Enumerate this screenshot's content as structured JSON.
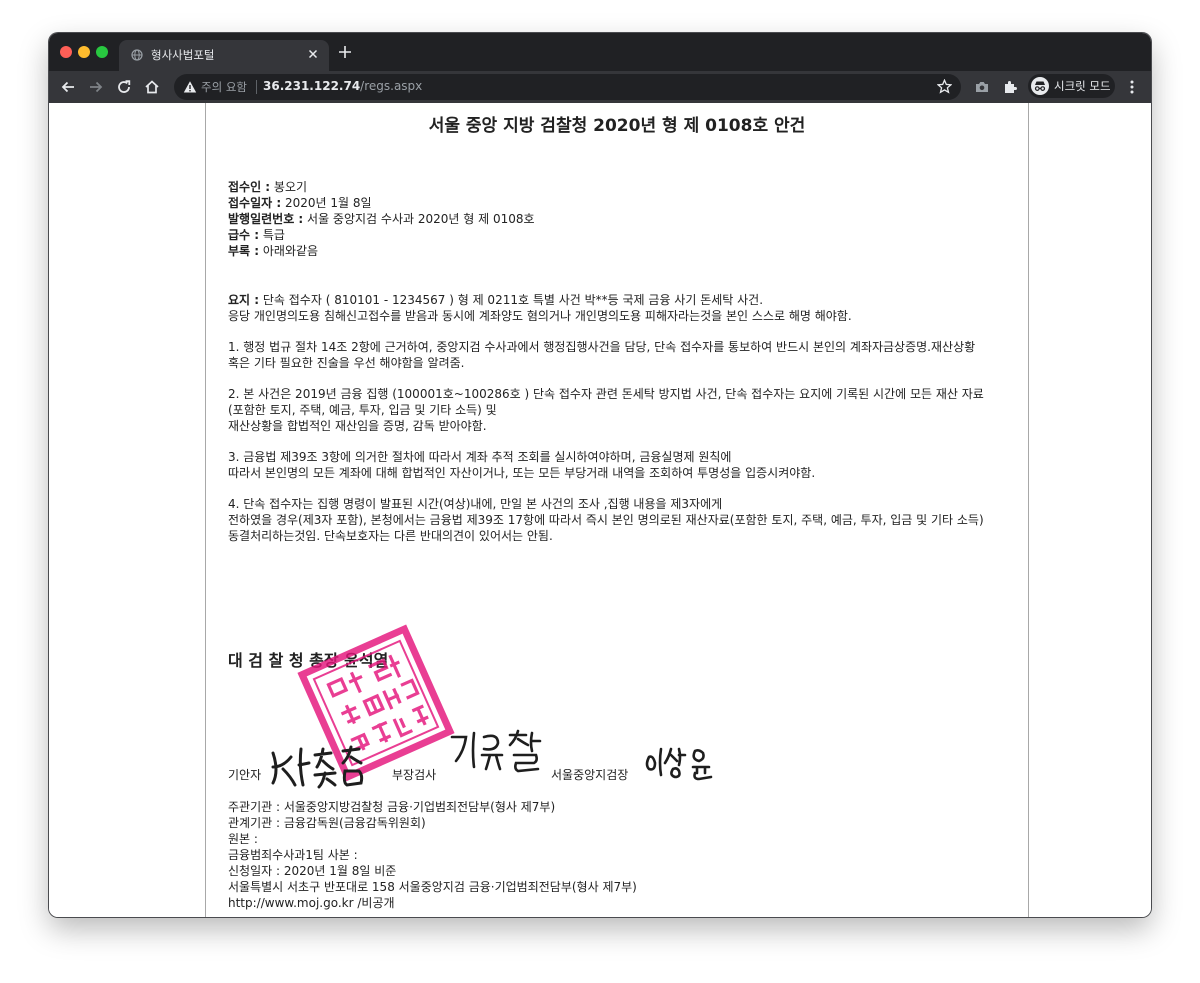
{
  "browser": {
    "tab_title": "형사사법포털",
    "security_label": "주의 요함",
    "url_host": "36.231.122.74",
    "url_path": "/regs.aspx",
    "incognito_label": "시크릿 모드"
  },
  "document": {
    "title": "서울 중앙 지방 검찰청 2020년 형 제 0108호 안건",
    "fields": [
      {
        "label": "접수인 :",
        "value": " 봉오기"
      },
      {
        "label": "접수일자 :",
        "value": " 2020년 1월 8일"
      },
      {
        "label": "발행일련번호 :",
        "value": " 서울 중앙지검 수사과 2020년 형 제 0108호"
      },
      {
        "label": "급수 :",
        "value": " 특급"
      },
      {
        "label": "부록 :",
        "value": " 아래와같음"
      }
    ],
    "summary_label": "요지 :",
    "summary_line1": " 단속 접수자 ( 810101 - 1234567 ) 형 제 0211호 특별 사건 박**등 국제 금융 사기 돈세탁 사건.",
    "summary_line2": "응당 개인명의도용 침해신고접수를 받음과 동시에 계좌양도 혐의거나 개인명의도용 피해자라는것을 본인 스스로 해명 해야함.",
    "p1_line1": "1. 행정 법규 절차 14조 2항에 근거하여,  중앙지검 수사과에서 행정집행사건을 담당,  단속 접수자를 통보하여 반드시 본인의 계좌자금상증명.재산상황",
    "p1_line2": "혹은 기타 필요한 진술을 우선 해야함을 알려줌.",
    "p2_line1": "2. 본 사건은 2019년 금융 집행  (100001호~100286호 )  단속 접수자 관련 돈세탁 방지법 사건,  단속 접수자는 요지에 기록된 시간에 모든 재산 자료",
    "p2_line2": "(포함한 토지, 주택, 예금, 투자, 입금 및 기타 소득) 및",
    "p2_line3": "재산상황을 합법적인 재산임을 증명, 감독 받아야함.",
    "p3_line1": "3. 금융법 제39조 3항에 의거한 절차에 따라서 계좌 추적 조회를 실시하여야하며, 금융실명제 원칙에",
    "p3_line2": "따라서 본인명의 모든 계좌에 대해 합법적인 자산이거나, 또는 모든 부당거래 내역을 조회하여 투명성을 입증시켜야함.",
    "p4_line1": "4. 단속 접수자는 집행 명령이 발표된 시간(여상)내에,  만일 본 사건의 조사 ,집행 내용을 제3자에게",
    "p4_line2": "전하였을 경우(제3자 포함), 본청에서는 금융법 제39조 17항에 따라서 즉시 본인 명의로된 재산자료(포함한 토지, 주택, 예금, 투자, 입금 및 기타 소득)",
    "p4_line3": "동결처리하는것임. 단속보호자는 다른 반대의견이 있어서는 안됨.",
    "authority": "대 검 찰 청 총장 윤석열",
    "drafter_label": "기안자",
    "drafter_signature": "신충섭",
    "chief_label": "부장검사",
    "chief_signature": "김유철",
    "head_label": "서울중앙지검장",
    "head_signature": "이성윤",
    "footer": [
      "주관기관 :  서울중앙지방검찰청 금융·기업범죄전담부(형사 제7부)",
      "관계기관 :  금융감독원(금융감독위원회)",
      "원본 :",
      "금융범죄수사과1팀 사본 :",
      "신청일자 :  2020년 1월 8일 비준",
      "서울특별시 서초구 반포대로 158 서울중앙지검 금융·기업범죄전담부(형사 제7부)",
      "http://www.moj.go.kr /비공개"
    ],
    "seal_text": "대검찰청총장관인"
  }
}
